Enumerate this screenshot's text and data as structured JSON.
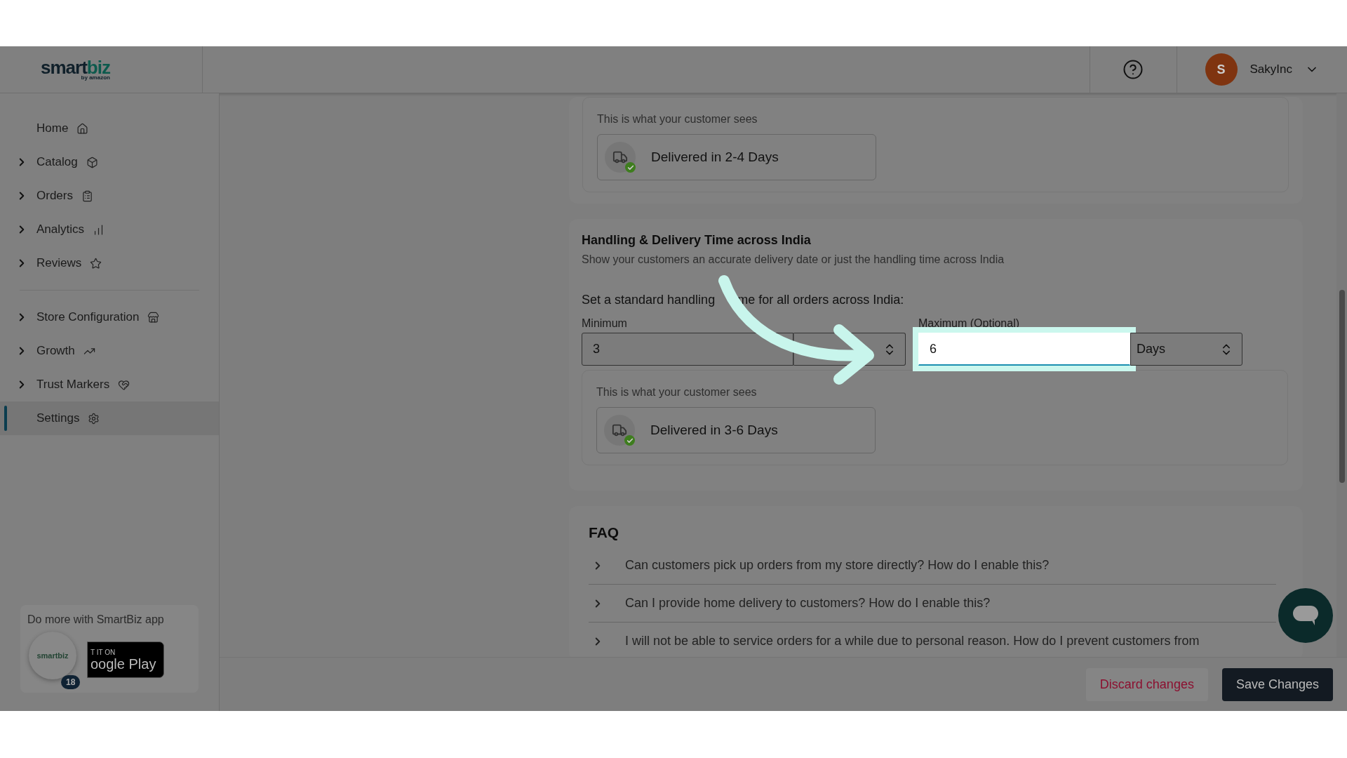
{
  "header": {
    "logo": {
      "part_1": "smart",
      "part_2": "biz",
      "tagline": "by amazon"
    },
    "user": {
      "initial": "S",
      "name": "SakyInc"
    }
  },
  "sidebar": {
    "groups": [
      [
        {
          "label": "Home",
          "expandable": false,
          "selected": false
        },
        {
          "label": "Catalog",
          "expandable": true,
          "selected": false
        },
        {
          "label": "Orders",
          "expandable": true,
          "selected": false
        },
        {
          "label": "Analytics",
          "expandable": true,
          "selected": false
        },
        {
          "label": "Reviews",
          "expandable": true,
          "selected": false
        }
      ],
      [
        {
          "label": "Store Configuration",
          "expandable": true,
          "selected": false
        },
        {
          "label": "Growth",
          "expandable": true,
          "selected": false
        },
        {
          "label": "Trust Markers",
          "expandable": true,
          "selected": false
        },
        {
          "label": "Settings",
          "expandable": false,
          "selected": true
        }
      ]
    ],
    "promo": {
      "text": "Do more with SmartBiz app",
      "badge_line_1": "T IT ON",
      "badge_line_2": "oogle Play",
      "avatar_logo": "smartbiz",
      "avatar_count": "18"
    }
  },
  "preview_top": {
    "label": "This is what your customer sees",
    "message": "Delivered in 2-4 Days"
  },
  "handling": {
    "title": "Handling & Delivery Time across India",
    "subtitle": "Show your customers an accurate delivery date or just the handling time across India",
    "prompt_start": "Set a standard handling",
    "prompt_end": "me for all orders across India:",
    "minimum": {
      "label": "Minimum",
      "value": "3",
      "focused": false
    },
    "maximum": {
      "label": "Maximum (Optional)",
      "value": "6",
      "unit": "Days",
      "focused": true
    },
    "preview": {
      "label": "This is what your customer sees",
      "message": "Delivered in 3-6 Days"
    }
  },
  "faq": {
    "title": "FAQ",
    "items": [
      {
        "question": "Can customers pick up orders from my store directly? How do I enable this?",
        "expanded": false
      },
      {
        "question": "Can I provide home delivery to customers? How do I enable this?",
        "expanded": false
      },
      {
        "question": "I will not be able to service orders for a while due to personal reason. How do I prevent customers from",
        "expanded": false
      }
    ]
  },
  "footer": {
    "discard": "Discard changes",
    "save": "Save Changes"
  }
}
